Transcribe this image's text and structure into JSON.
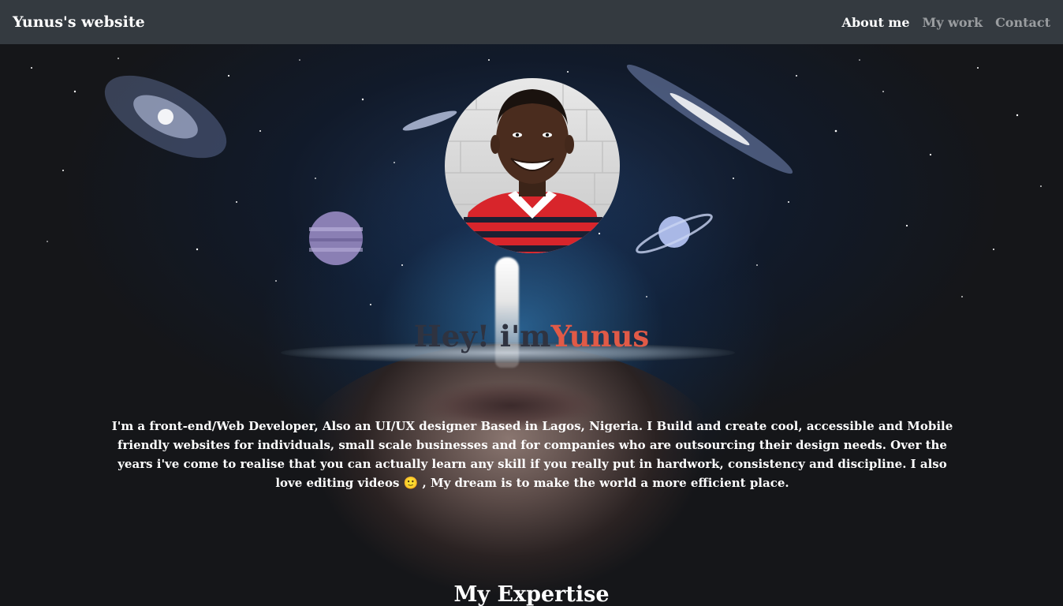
{
  "navbar": {
    "brand": "Yunus's website",
    "links": [
      "About me",
      "My work",
      "Contact"
    ]
  },
  "hero": {
    "greeting": "Hey! i'm",
    "name": "Yunus",
    "bio": "I'm a front-end/Web Developer, Also an UI/UX designer Based in Lagos, Nigeria. I Build and create cool, accessible and Mobile friendly websites for individuals, small scale businesses and for companies who are outsourcing their design needs. Over the years i've come to realise that you can actually learn any skill if you really put in hardwork, consistency and discipline. I also love editing videos 🙂 , My dream is to make the world a more efficient place."
  },
  "sections": {
    "expertise_title": "My Expertise"
  },
  "colors": {
    "navbar": "#343a40",
    "accent": "#e05a47",
    "headline": "#2f3340"
  }
}
